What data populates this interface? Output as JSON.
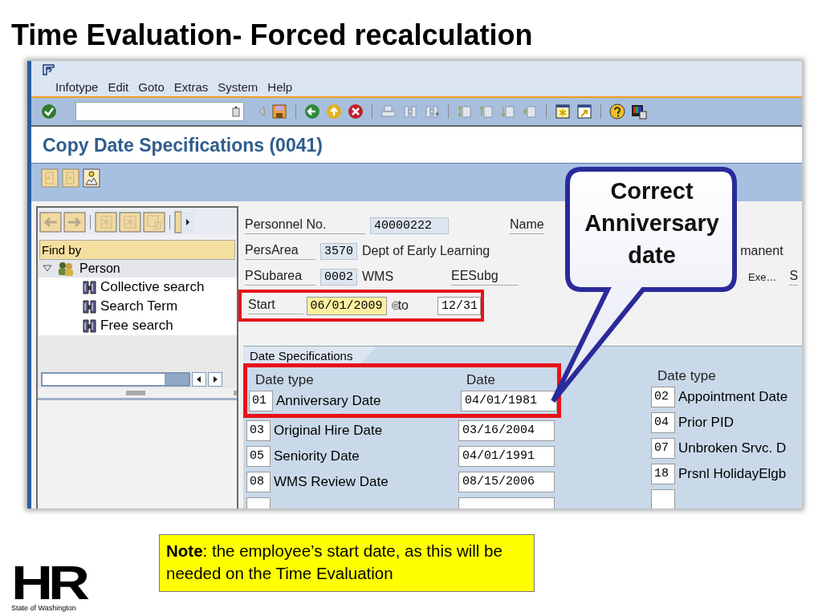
{
  "slide_title": "Time Evaluation- Forced recalculation",
  "menu": [
    "Infotype",
    "Edit",
    "Goto",
    "Extras",
    "System",
    "Help"
  ],
  "screen_title": "Copy Date Specifications (0041)",
  "left_panel": {
    "find_by": "Find by",
    "tree": [
      {
        "label": "Person",
        "expanded": true,
        "children": [
          {
            "label": "Collective search"
          },
          {
            "label": "Search Term"
          },
          {
            "label": "Free search"
          }
        ]
      }
    ]
  },
  "header": {
    "personnel_no_label": "Personnel No.",
    "personnel_no": "40000222",
    "name_label": "Name",
    "persarea_label": "PersArea",
    "persarea_code": "3570",
    "persarea_text": "Dept of Early Learning",
    "persarea_right": "manent",
    "psubarea_label": "PSubarea",
    "psubarea_code": "0002",
    "psubarea_text": "WMS",
    "eesubg_label": "EESubg",
    "eesubg_text": "Exe…",
    "eesubg_right": "S",
    "start_label": "Start",
    "start": "06/01/2009",
    "start_highlighted": true,
    "to_label": "to",
    "to": "12/31"
  },
  "date_specifications": {
    "tab": "Date Specifications",
    "columns": [
      "Date type",
      "Date",
      "Date type"
    ],
    "left_rows": [
      {
        "code": "01",
        "type": "Anniversary Date",
        "date": "04/01/1981",
        "highlighted": true
      },
      {
        "code": "03",
        "type": "Original Hire Date",
        "date": "03/16/2004",
        "highlighted": false
      },
      {
        "code": "05",
        "type": "Seniority Date",
        "date": "04/01/1991",
        "highlighted": false
      },
      {
        "code": "08",
        "type": "WMS Review Date",
        "date": "08/15/2006",
        "highlighted": false
      }
    ],
    "right_rows": [
      {
        "code": "02",
        "type": "Appointment Date"
      },
      {
        "code": "04",
        "type": "Prior PID"
      },
      {
        "code": "07",
        "type": "Unbroken Srvc. D"
      },
      {
        "code": "18",
        "type": "Prsnl HolidayElgb"
      }
    ]
  },
  "callout": "Correct Anniversary date",
  "note": "**Note**: the employee’s start date, as this will be needed on the Time Evaluation",
  "logo": {
    "mark": "HR",
    "caption": "State of Washington"
  }
}
